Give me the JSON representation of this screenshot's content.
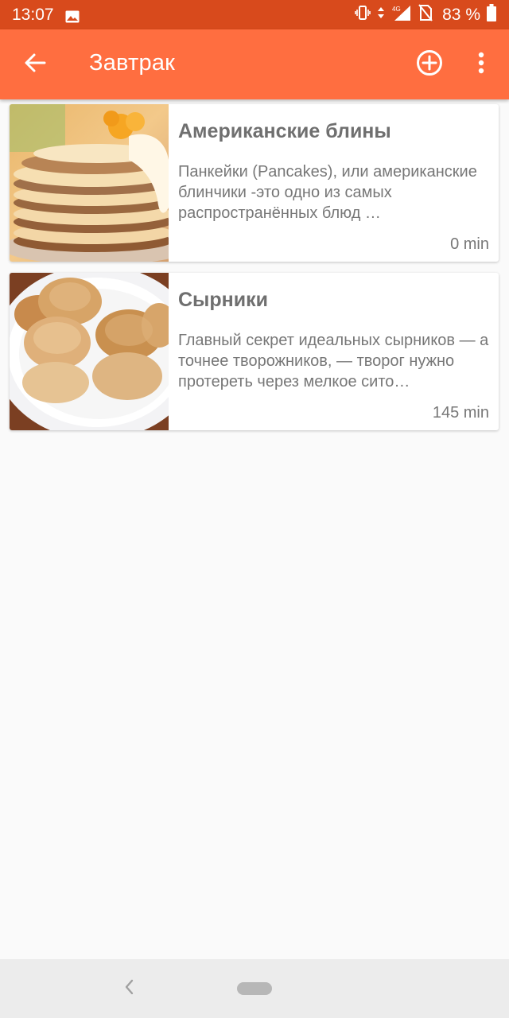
{
  "status_bar": {
    "time": "13:07",
    "network": "4G",
    "battery": "83 %",
    "icons": [
      "image-icon",
      "vibrate-icon",
      "data-arrows-icon",
      "signal-icon",
      "no-sim-icon",
      "battery-icon"
    ]
  },
  "app_bar": {
    "title": "Завтрак",
    "icons": [
      "back-arrow-icon",
      "add-circle-icon",
      "more-vert-icon"
    ]
  },
  "recipes": [
    {
      "title": "Американские блины",
      "description": "Панкейки (Pancakes), или американские блинчики -это одно из самых распространённых блюд …",
      "time": "0 min",
      "thumbnail": "pancakes-photo"
    },
    {
      "title": "Сырники",
      "description": "Главный секрет идеальных сырников — а точнее творожников, — творог нужно протереть через мелкое сито…",
      "time": "145 min",
      "thumbnail": "syrniki-photo"
    }
  ],
  "colors": {
    "status_bar": "#d84a1c",
    "app_bar": "#ff6e40",
    "background": "#fafafa",
    "text_primary": "#6f6f6f",
    "text_secondary": "#777777",
    "nav_bar": "#ececec"
  }
}
